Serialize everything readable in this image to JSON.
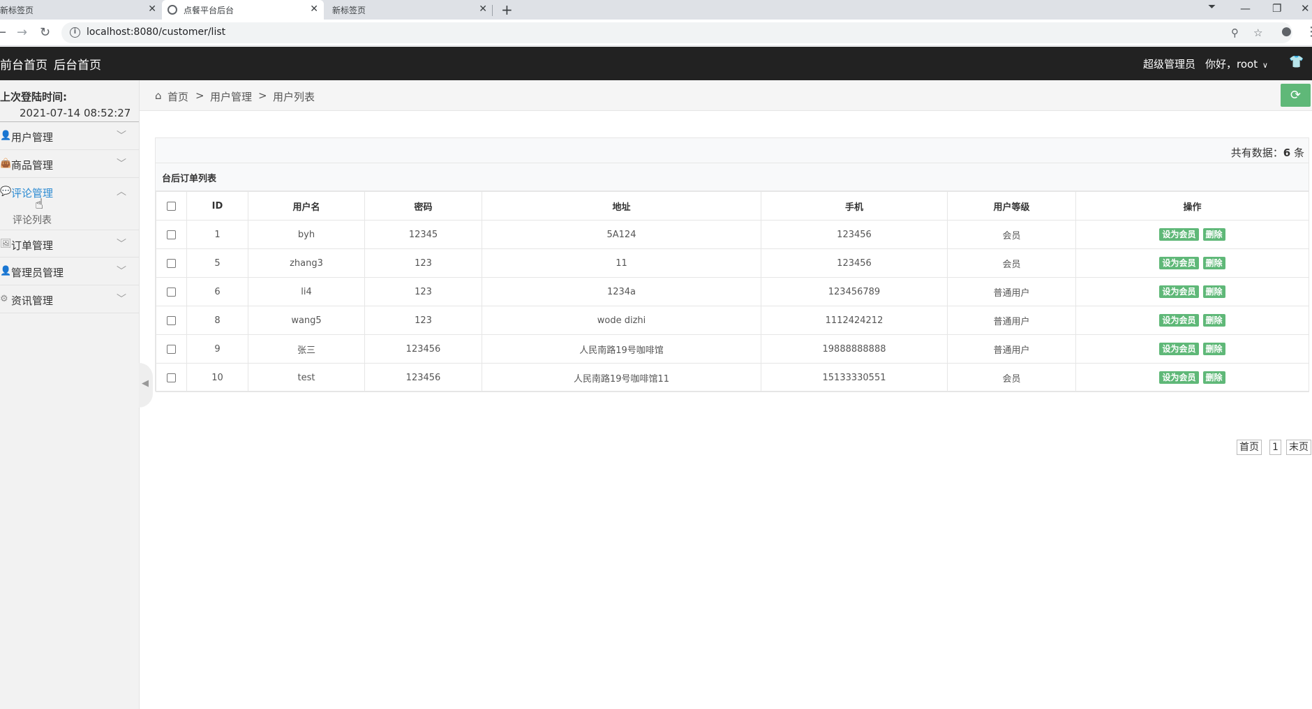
{
  "browser": {
    "tabs": [
      {
        "title": "新标签页",
        "active": false
      },
      {
        "title": "点餐平台后台",
        "active": true
      },
      {
        "title": "新标签页",
        "active": false
      }
    ],
    "url": "localhost:8080/customer/list"
  },
  "header": {
    "nav": [
      "前台首页",
      "后台首页"
    ],
    "role": "超级管理员",
    "greeting": "你好，root"
  },
  "sidebar": {
    "login_label": "上次登陆时间:",
    "login_time": "2021-07-14 08:52:27",
    "menus": [
      {
        "label": "用户管理",
        "icon": "user-icon"
      },
      {
        "label": "商品管理",
        "icon": "bag-icon"
      },
      {
        "label": "评论管理",
        "icon": "comment-icon",
        "active": true,
        "children": [
          "评论列表"
        ]
      },
      {
        "label": "订单管理",
        "icon": "image-icon"
      },
      {
        "label": "管理员管理",
        "icon": "user-icon"
      },
      {
        "label": "资讯管理",
        "icon": "gear-icon"
      }
    ]
  },
  "breadcrumb": [
    "首页",
    "用户管理",
    "用户列表"
  ],
  "breadcrumb_sep": ">",
  "panel": {
    "total_prefix": "共有数据：",
    "total_count": "6",
    "total_suffix": " 条",
    "title": "台后订单列表"
  },
  "table": {
    "headers": [
      "ID",
      "用户名",
      "密码",
      "地址",
      "手机",
      "用户等级",
      "操作"
    ],
    "rows": [
      {
        "id": "1",
        "username": "byh",
        "password": "12345",
        "address": "5A124",
        "phone": "123456",
        "level": "会员"
      },
      {
        "id": "5",
        "username": "zhang3",
        "password": "123",
        "address": "11",
        "phone": "123456",
        "level": "会员"
      },
      {
        "id": "6",
        "username": "li4",
        "password": "123",
        "address": "1234a",
        "phone": "123456789",
        "level": "普通用户"
      },
      {
        "id": "8",
        "username": "wang5",
        "password": "123",
        "address": "wode dizhi",
        "phone": "1112424212",
        "level": "普通用户"
      },
      {
        "id": "9",
        "username": "张三",
        "password": "123456",
        "address": "人民南路19号咖啡馆",
        "phone": "19888888888",
        "level": "普通用户"
      },
      {
        "id": "10",
        "username": "test",
        "password": "123456",
        "address": "人民南路19号咖啡馆11",
        "phone": "15133330551",
        "level": "会员"
      }
    ],
    "actions": {
      "set_member": "设为会员",
      "delete": "删除"
    }
  },
  "pager": {
    "first": "首页",
    "current": "1",
    "last": "末页"
  },
  "colors": {
    "accent_green": "#5fb878",
    "header_bg": "#222222",
    "active_blue": "#2c8bd2"
  }
}
